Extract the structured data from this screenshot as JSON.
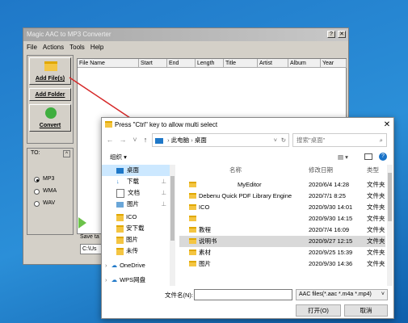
{
  "app": {
    "title": "Magic AAC to MP3 Converter",
    "menu": [
      "File",
      "Actions",
      "Tools",
      "Help"
    ],
    "buttons": {
      "add_files": "Add File(s)",
      "add_folder": "Add Folder",
      "convert": "Convert"
    },
    "columns": [
      "File Name",
      "Start",
      "End",
      "Length",
      "Title",
      "Artist",
      "Album",
      "Year"
    ],
    "to_label": "TO:",
    "formats": [
      "MP3",
      "WMA",
      "WAV"
    ],
    "selected_format": "MP3",
    "save_label": "Save ta",
    "save_path": "C:\\Us"
  },
  "dialog": {
    "title": "Press \"Ctrl\" key to allow multi select",
    "address": [
      "此电脑",
      "桌面"
    ],
    "search_placeholder": "搜索\"桌面\"",
    "organize": "组织",
    "tree": [
      {
        "label": "桌面",
        "selected": true
      },
      {
        "label": "下载"
      },
      {
        "label": "文档"
      },
      {
        "label": "图片"
      },
      {
        "label": "ICO"
      },
      {
        "label": "安下载"
      },
      {
        "label": "图片"
      },
      {
        "label": "未传"
      },
      {
        "label": "OneDrive"
      },
      {
        "label": "WPS网盘"
      }
    ],
    "list_headers": [
      "名称",
      "修改日期",
      "类型"
    ],
    "files": [
      {
        "name": "MyEditor",
        "date": "2020/6/4 14:28",
        "type": "文件夹"
      },
      {
        "name": "Debenu Quick PDF Library Engine",
        "date": "2020/7/1 8:25",
        "type": "文件夹"
      },
      {
        "name": "ICO",
        "date": "2020/9/30 14:01",
        "type": "文件夹"
      },
      {
        "name": "",
        "date": "2020/9/30 14:15",
        "type": "文件夹"
      },
      {
        "name": "教程",
        "date": "2020/7/4 16:09",
        "type": "文件夹"
      },
      {
        "name": "说明书",
        "date": "2020/9/27 12:15",
        "type": "文件夹"
      },
      {
        "name": "素材",
        "date": "2020/9/25 15:39",
        "type": "文件夹"
      },
      {
        "name": "图片",
        "date": "2020/9/30 14:36",
        "type": "文件夹"
      }
    ],
    "filename_label": "文件名(N):",
    "filename_value": "",
    "filter": "AAC files(*.aac *.m4a *.mp4)",
    "open_button": "打开(O)",
    "cancel_button": "取消"
  },
  "colors": {
    "desktop": "#1f78c8",
    "arrow": "#d62828",
    "selection": "#cce8ff"
  }
}
